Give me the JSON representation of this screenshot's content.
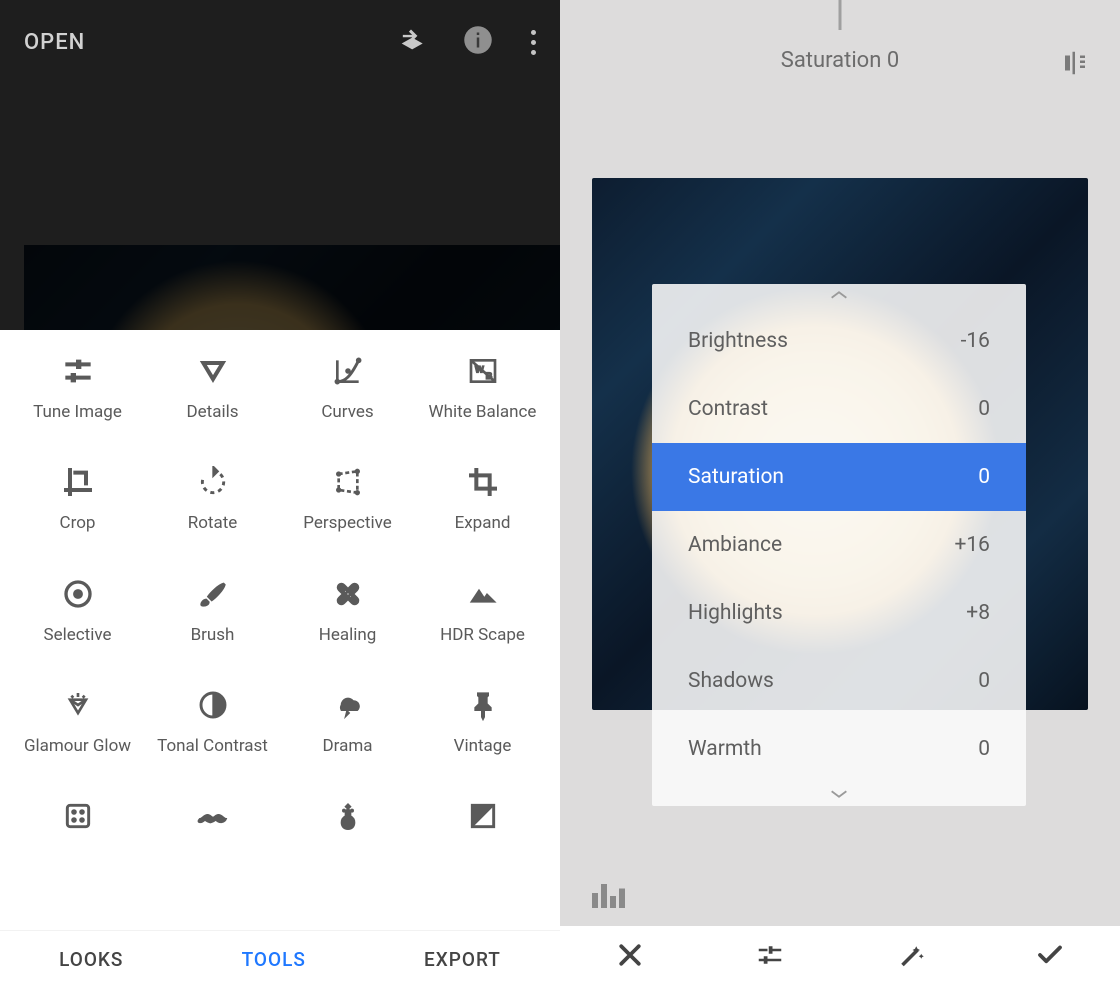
{
  "left": {
    "header": {
      "open_label": "OPEN"
    },
    "tools": [
      {
        "id": "tune-image",
        "label": "Tune Image"
      },
      {
        "id": "details",
        "label": "Details"
      },
      {
        "id": "curves",
        "label": "Curves"
      },
      {
        "id": "white-balance",
        "label": "White Balance"
      },
      {
        "id": "crop",
        "label": "Crop"
      },
      {
        "id": "rotate",
        "label": "Rotate"
      },
      {
        "id": "perspective",
        "label": "Perspective"
      },
      {
        "id": "expand",
        "label": "Expand"
      },
      {
        "id": "selective",
        "label": "Selective"
      },
      {
        "id": "brush",
        "label": "Brush"
      },
      {
        "id": "healing",
        "label": "Healing"
      },
      {
        "id": "hdr-scape",
        "label": "HDR Scape"
      },
      {
        "id": "glamour-glow",
        "label": "Glamour Glow"
      },
      {
        "id": "tonal-contrast",
        "label": "Tonal Contrast"
      },
      {
        "id": "drama",
        "label": "Drama"
      },
      {
        "id": "vintage",
        "label": "Vintage"
      },
      {
        "id": "grainy-film",
        "label": ""
      },
      {
        "id": "retrolux",
        "label": ""
      },
      {
        "id": "grunge",
        "label": ""
      },
      {
        "id": "bw",
        "label": ""
      }
    ],
    "tabs": {
      "looks": "LOOKS",
      "tools": "TOOLS",
      "export": "EXPORT",
      "active": "tools"
    }
  },
  "right": {
    "header_title": "Saturation 0",
    "params": [
      {
        "name": "Brightness",
        "value": "-16",
        "selected": false
      },
      {
        "name": "Contrast",
        "value": "0",
        "selected": false
      },
      {
        "name": "Saturation",
        "value": "0",
        "selected": true
      },
      {
        "name": "Ambiance",
        "value": "+16",
        "selected": false
      },
      {
        "name": "Highlights",
        "value": "+8",
        "selected": false
      },
      {
        "name": "Shadows",
        "value": "0",
        "selected": false
      },
      {
        "name": "Warmth",
        "value": "0",
        "selected": false
      }
    ]
  },
  "colors": {
    "accent": "#3a78e6",
    "link": "#1f78ff"
  }
}
